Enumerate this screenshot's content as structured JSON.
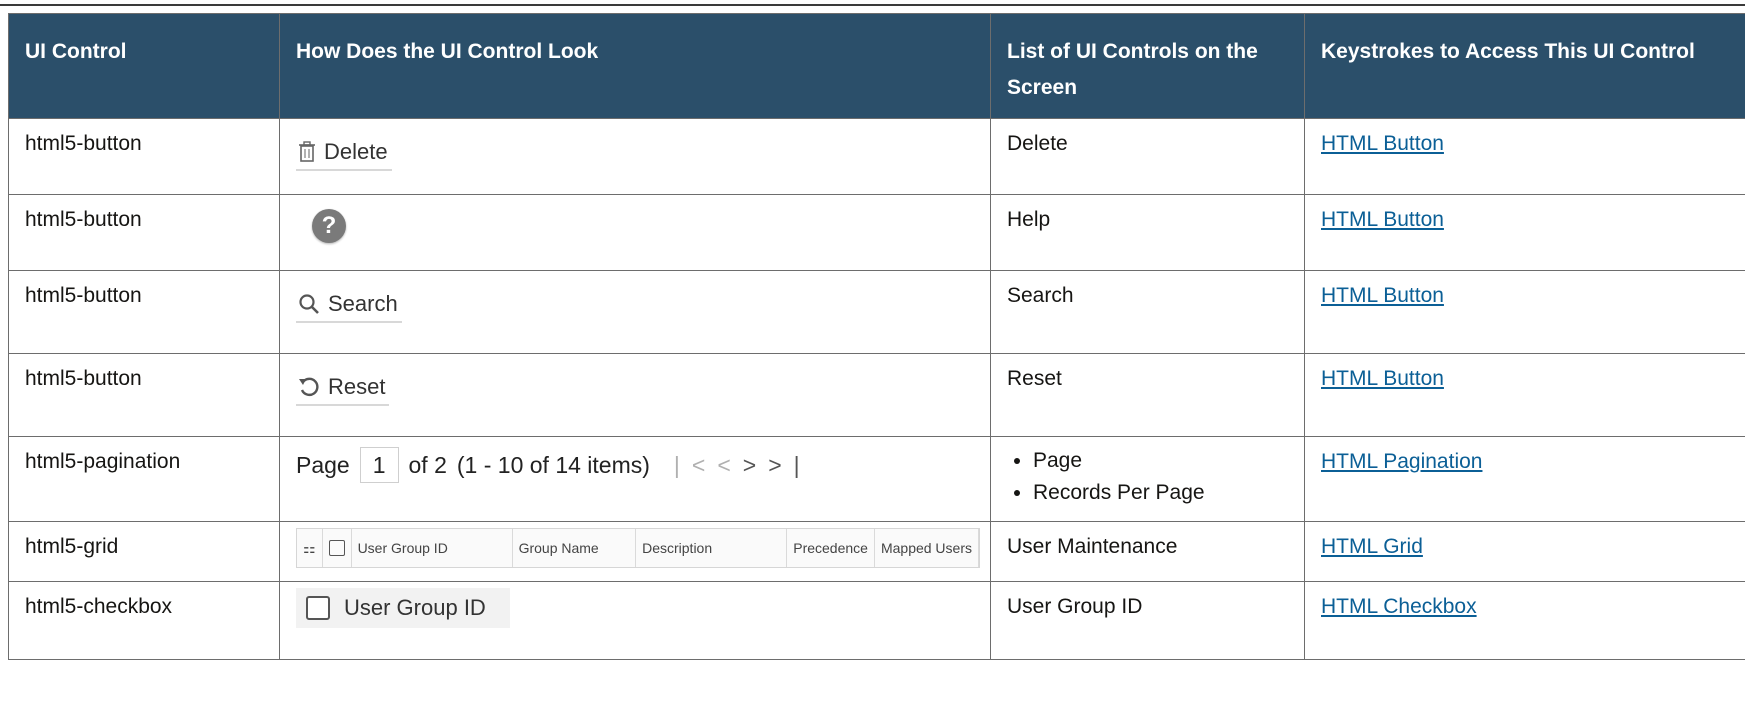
{
  "headers": [
    "UI Control",
    "How Does the UI Control Look",
    "List of UI Controls on the Screen",
    "Keystrokes to Access This UI Control"
  ],
  "rows": [
    {
      "control": "html5-button",
      "look_label": "Delete",
      "list": "Delete",
      "link": "HTML Button"
    },
    {
      "control": "html5-button",
      "look_label": "",
      "list": "Help",
      "link": "HTML Button"
    },
    {
      "control": "html5-button",
      "look_label": "Search",
      "list": "Search",
      "link": "HTML Button"
    },
    {
      "control": "html5-button",
      "look_label": "Reset",
      "list": "Reset",
      "link": "HTML Button"
    },
    {
      "control": "html5-pagination",
      "list_items": [
        "Page",
        "Records Per Page"
      ],
      "link": "HTML Pagination",
      "pagination": {
        "page_label": "Page",
        "page_value": "1",
        "of_text": "of 2",
        "items_text": "(1 - 10 of  14  items)"
      }
    },
    {
      "control": "html5-grid",
      "list": "User Maintenance",
      "link": "HTML Grid",
      "grid_columns": [
        "User Group ID",
        "Group Name",
        "Description",
        "Precedence",
        "Mapped Users"
      ]
    },
    {
      "control": "html5-checkbox",
      "look_label": "User Group ID",
      "list": "User Group ID",
      "link": "HTML Checkbox"
    }
  ]
}
